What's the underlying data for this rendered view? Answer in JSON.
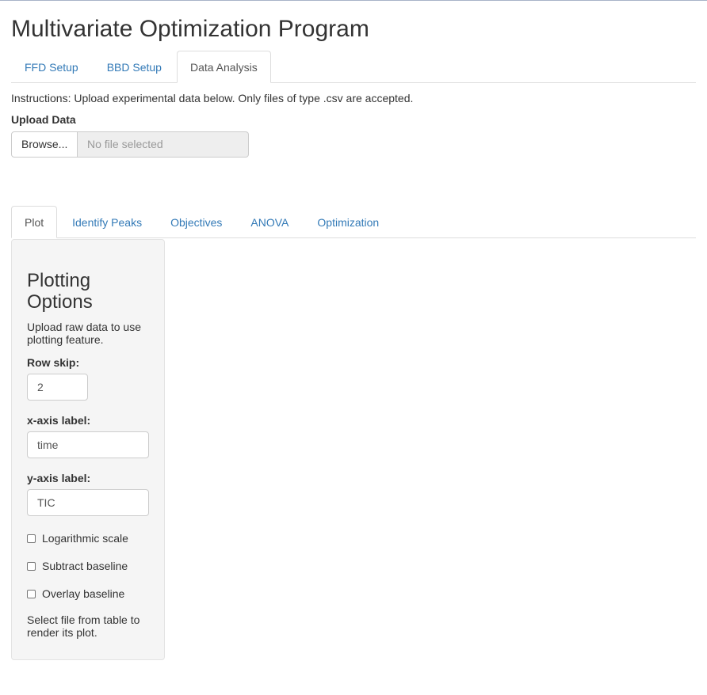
{
  "app": {
    "title": "Multivariate Optimization Program"
  },
  "main_tabs": [
    {
      "label": "FFD Setup",
      "active": false
    },
    {
      "label": "BBD Setup",
      "active": false
    },
    {
      "label": "Data Analysis",
      "active": true
    }
  ],
  "instructions": "Instructions: Upload experimental data below. Only files of type .csv are accepted.",
  "upload": {
    "label": "Upload Data",
    "browse_label": "Browse...",
    "file_placeholder": "No file selected"
  },
  "analysis_tabs": [
    {
      "label": "Plot",
      "active": true
    },
    {
      "label": "Identify Peaks",
      "active": false
    },
    {
      "label": "Objectives",
      "active": false
    },
    {
      "label": "ANOVA",
      "active": false
    },
    {
      "label": "Optimization",
      "active": false
    }
  ],
  "plot_options": {
    "title": "Plotting Options",
    "help": "Upload raw data to use plotting feature.",
    "row_skip": {
      "label": "Row skip:",
      "value": "2"
    },
    "x_axis": {
      "label": "x-axis label:",
      "value": "time"
    },
    "y_axis": {
      "label": "y-axis label:",
      "value": "TIC"
    },
    "checkboxes": [
      {
        "label": "Logarithmic scale",
        "checked": false
      },
      {
        "label": "Subtract baseline",
        "checked": false
      },
      {
        "label": "Overlay baseline",
        "checked": false
      }
    ],
    "footer": "Select file from table to render its plot."
  },
  "colors": {
    "link": "#337ab7",
    "active_tab_text": "#555555",
    "sidebar_bg": "#f5f5f5",
    "disabled_bg": "#eeeeee"
  }
}
